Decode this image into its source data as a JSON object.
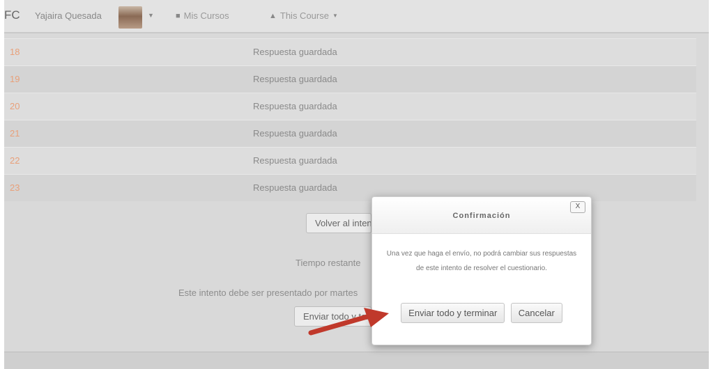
{
  "navbar": {
    "brand": "FC",
    "user_name": "Yajaira Quesada",
    "my_courses": "Mis Cursos",
    "this_course": "This Course"
  },
  "summary": {
    "rows": [
      {
        "number": "18",
        "status": "Respuesta guardada"
      },
      {
        "number": "19",
        "status": "Respuesta guardada"
      },
      {
        "number": "20",
        "status": "Respuesta guardada"
      },
      {
        "number": "21",
        "status": "Respuesta guardada"
      },
      {
        "number": "22",
        "status": "Respuesta guardada"
      },
      {
        "number": "23",
        "status": "Respuesta guardada"
      }
    ],
    "return_button": "Volver al intento",
    "time_left": "Tiempo restante",
    "deadline_text": "Este intento debe ser presentado por martes",
    "submit_button": "Enviar todo y terminar"
  },
  "modal": {
    "title": "Confirmación",
    "close": "X",
    "body": "Una vez que haga el envío, no podrá cambiar sus respuestas de este intento de resolver el cuestionario.",
    "confirm_button": "Enviar todo y terminar",
    "cancel_button": "Cancelar"
  },
  "colors": {
    "arrow": "#c0392b",
    "question_number": "#e8a07a"
  }
}
